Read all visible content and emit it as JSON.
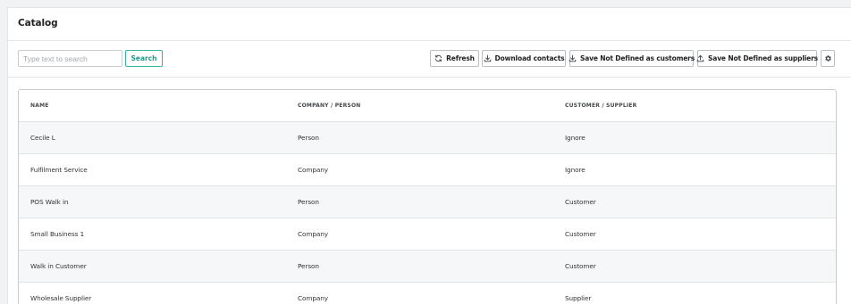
{
  "card": {
    "title": "Catalog"
  },
  "toolbar": {
    "search_placeholder": "Type text to search",
    "search_value": "",
    "search_label": "Search",
    "refresh_label": "Refresh",
    "download_label": "Download contacts",
    "save_customers_label": "Save Not Defined as customers",
    "save_suppliers_label": "Save Not Defined as suppliers",
    "accent_color": "#34b4a4"
  },
  "table": {
    "headers": [
      "NAME",
      "COMPANY / PERSON",
      "CUSTOMER / SUPPLIER"
    ],
    "rows": [
      [
        "Cecile L",
        "Person",
        "Ignore"
      ],
      [
        "Fulfilment Service",
        "Company",
        "Ignore"
      ],
      [
        "POS Walk in",
        "Person",
        "Customer"
      ],
      [
        "Small Business 1",
        "Company",
        "Customer"
      ],
      [
        "Walk in Customer",
        "Person",
        "Customer"
      ],
      [
        "Wholesale Supplier",
        "Company",
        "Supplier"
      ]
    ]
  },
  "icons": {
    "refresh": "refresh-icon",
    "download": "download-icon",
    "upload": "upload-icon",
    "settings": "gear-icon"
  }
}
